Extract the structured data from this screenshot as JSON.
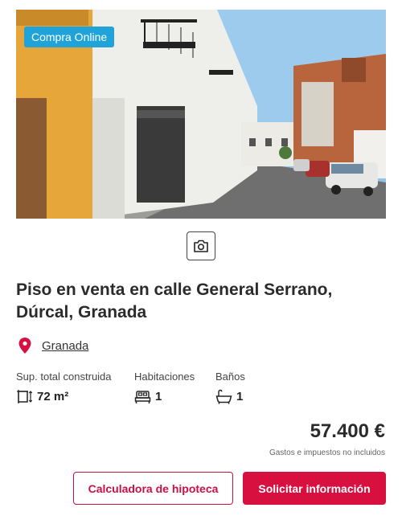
{
  "listing": {
    "badge": "Compra Online",
    "title": "Piso en venta en calle General Serrano, Dúrcal, Granada",
    "location": "Granada",
    "price": "57.400 €",
    "tax_note": "Gastos e impuestos no incluidos"
  },
  "features": {
    "area": {
      "label": "Sup. total construida",
      "value": "72 m²",
      "icon": "area-icon"
    },
    "rooms": {
      "label": "Habitaciones",
      "value": "1",
      "icon": "bed-icon"
    },
    "baths": {
      "label": "Baños",
      "value": "1",
      "icon": "bath-icon"
    }
  },
  "actions": {
    "mortgage_label": "Calculadora de hipoteca",
    "request_label": "Solicitar información"
  },
  "icons": {
    "gallery": "camera-icon",
    "location": "map-pin-icon"
  },
  "colors": {
    "badge": "#1fa3d9",
    "accent": "#d8103f",
    "pin": "#d8103f"
  }
}
